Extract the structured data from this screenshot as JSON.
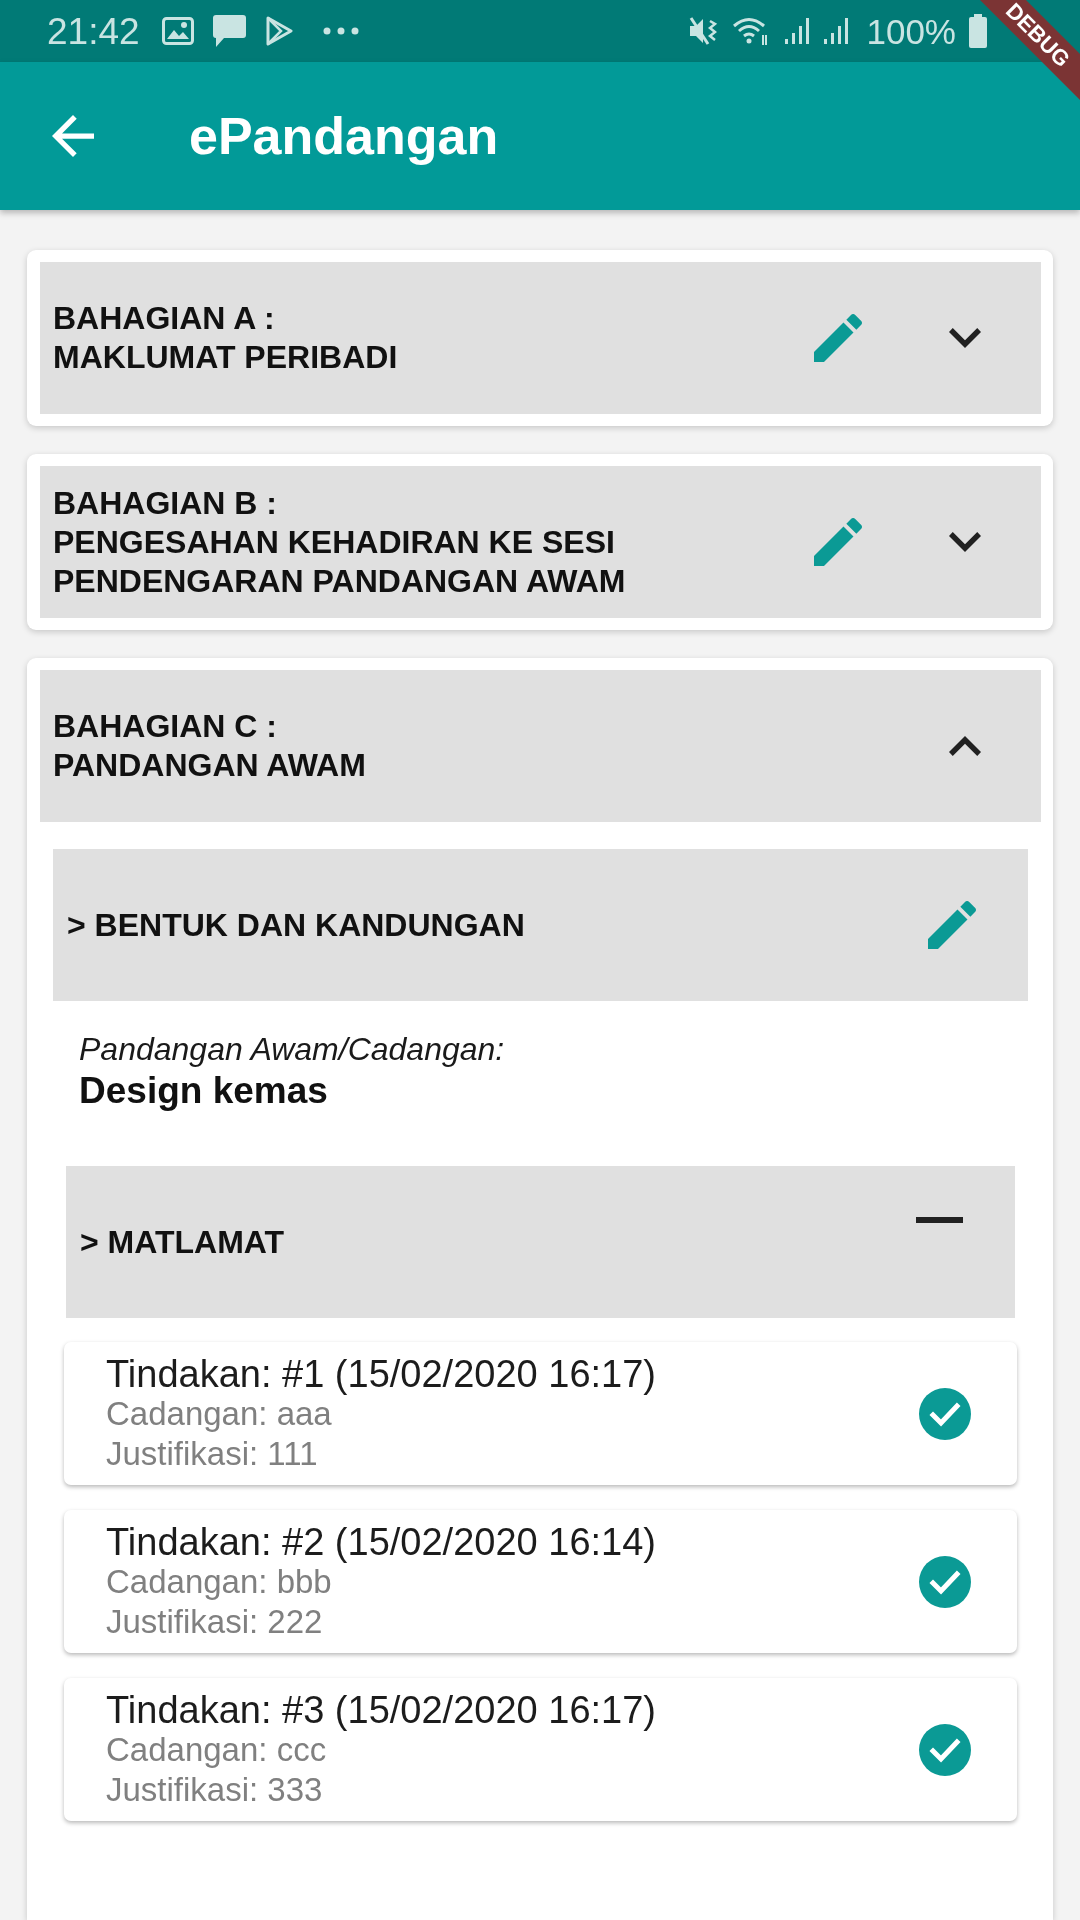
{
  "status_bar": {
    "time": "21:42",
    "battery": "100%"
  },
  "debug_banner": {
    "label": "DEBUG"
  },
  "app_bar": {
    "title": "ePandangan"
  },
  "sections": [
    {
      "label": "BAHAGIAN A :",
      "title": "MAKLUMAT PERIBADI",
      "editable": true,
      "expanded": false
    },
    {
      "label": "BAHAGIAN B :",
      "title": "PENGESAHAN KEHADIRAN KE SESI PENDENGARAN PANDANGAN AWAM",
      "editable": true,
      "expanded": false
    },
    {
      "label": "BAHAGIAN C :",
      "title": "PANDANGAN AWAM",
      "editable": false,
      "expanded": true,
      "subsections": [
        {
          "kind": "answer",
          "title": "> BENTUK DAN KANDUNGAN",
          "field_label": "Pandangan Awam/Cadangan:",
          "value": "Design kemas"
        },
        {
          "kind": "actions",
          "title": "> MATLAMAT",
          "actions": [
            {
              "title": "Tindakan: #1 (15/02/2020 16:17)",
              "proposal": "Cadangan: aaa",
              "justification": "Justifikasi: 111",
              "done": true
            },
            {
              "title": "Tindakan: #2 (15/02/2020 16:14)",
              "proposal": "Cadangan: bbb",
              "justification": "Justifikasi: 222",
              "done": true
            },
            {
              "title": "Tindakan: #3 (15/02/2020 16:17)",
              "proposal": "Cadangan: ccc",
              "justification": "Justifikasi: 333",
              "done": true
            }
          ]
        }
      ]
    }
  ]
}
